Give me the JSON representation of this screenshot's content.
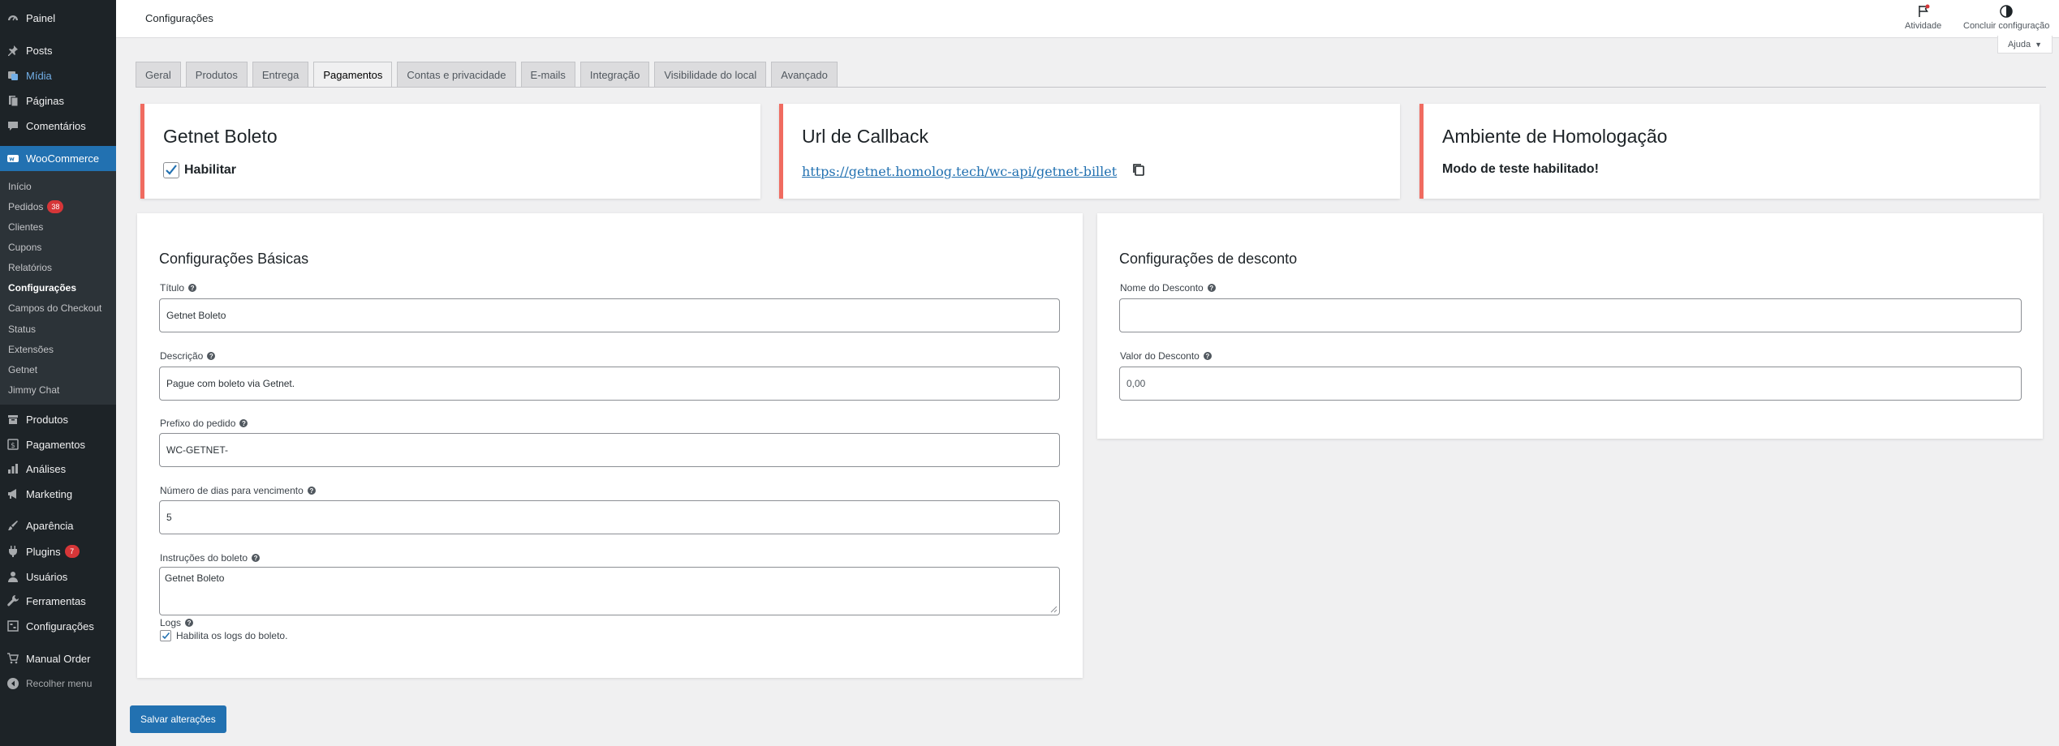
{
  "sidebar": {
    "items": [
      {
        "label": "Painel",
        "icon": "dashboard-icon"
      },
      {
        "label": "Posts",
        "icon": "pin-icon"
      },
      {
        "label": "Mídia",
        "icon": "media-icon"
      },
      {
        "label": "Páginas",
        "icon": "pages-icon"
      },
      {
        "label": "Comentários",
        "icon": "comment-icon"
      },
      {
        "label": "WooCommerce",
        "icon": "woo-icon"
      }
    ],
    "woo_submenu": [
      {
        "label": "Início"
      },
      {
        "label": "Pedidos",
        "badge": "38"
      },
      {
        "label": "Clientes"
      },
      {
        "label": "Cupons"
      },
      {
        "label": "Relatórios"
      },
      {
        "label": "Configurações"
      },
      {
        "label": "Campos do Checkout"
      },
      {
        "label": "Status"
      },
      {
        "label": "Extensões"
      },
      {
        "label": "Getnet"
      },
      {
        "label": "Jimmy Chat"
      }
    ],
    "items_bottom": [
      {
        "label": "Produtos",
        "icon": "archive-icon"
      },
      {
        "label": "Pagamentos",
        "icon": "money-icon"
      },
      {
        "label": "Análises",
        "icon": "chart-icon"
      },
      {
        "label": "Marketing",
        "icon": "megaphone-icon"
      },
      {
        "label": "Aparência",
        "icon": "brush-icon"
      },
      {
        "label": "Plugins",
        "icon": "plug-icon",
        "badge": "7"
      },
      {
        "label": "Usuários",
        "icon": "user-icon"
      },
      {
        "label": "Ferramentas",
        "icon": "wrench-icon"
      },
      {
        "label": "Configurações",
        "icon": "settings-icon"
      },
      {
        "label": "Manual Order",
        "icon": "cart-icon"
      },
      {
        "label": "Recolher menu",
        "icon": "collapse-icon"
      }
    ]
  },
  "header": {
    "title": "Configurações",
    "activity_label": "Atividade",
    "finish_setup_label": "Concluir configuração",
    "help_label": "Ajuda"
  },
  "tabs": [
    {
      "label": "Geral"
    },
    {
      "label": "Produtos"
    },
    {
      "label": "Entrega"
    },
    {
      "label": "Pagamentos"
    },
    {
      "label": "Contas e privacidade"
    },
    {
      "label": "E-mails"
    },
    {
      "label": "Integração"
    },
    {
      "label": "Visibilidade do local"
    },
    {
      "label": "Avançado"
    }
  ],
  "notices": {
    "boleto": {
      "title": "Getnet Boleto",
      "enable_label": "Habilitar"
    },
    "callback": {
      "title": "Url de Callback",
      "url": "https://getnet.homolog.tech/wc-api/getnet-billet"
    },
    "environment": {
      "title": "Ambiente de Homologação",
      "text": "Modo de teste habilitado!"
    }
  },
  "basic": {
    "heading": "Configurações Básicas",
    "title_label": "Título",
    "title_value": "Getnet Boleto",
    "description_label": "Descrição",
    "description_value": "Pague com boleto via Getnet.",
    "prefix_label": "Prefixo do pedido",
    "prefix_value": "WC-GETNET-",
    "days_label": "Número de dias para vencimento",
    "days_value": "5",
    "instructions_label": "Instruções do boleto",
    "instructions_value": "Getnet Boleto",
    "logs_label": "Logs",
    "logs_checkbox_label": "Habilita os logs do boleto."
  },
  "discount": {
    "heading": "Configurações de desconto",
    "name_label": "Nome do Desconto",
    "name_value": "",
    "value_label": "Valor do Desconto",
    "value_placeholder": "0,00"
  },
  "save_label": "Salvar alterações"
}
